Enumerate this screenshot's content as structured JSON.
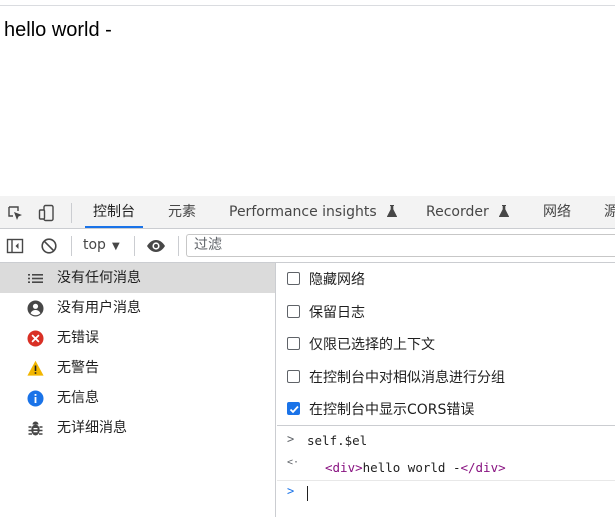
{
  "page": {
    "text": "hello world -"
  },
  "devtools": {
    "tabs": [
      {
        "label": "控制台",
        "active": true
      },
      {
        "label": "元素",
        "active": false
      },
      {
        "label": "Performance insights",
        "active": false,
        "experimental": true
      },
      {
        "label": "Recorder",
        "active": false,
        "experimental": true
      },
      {
        "label": "网络",
        "active": false
      },
      {
        "label": "源",
        "active": false
      }
    ]
  },
  "toolbar": {
    "context_value": "top",
    "filter_placeholder": "过滤"
  },
  "sidebar": {
    "items": [
      {
        "label": "没有任何消息",
        "icon": "list-icon",
        "selected": true
      },
      {
        "label": "没有用户消息",
        "icon": "user-icon",
        "selected": false
      },
      {
        "label": "无错误",
        "icon": "error-icon",
        "selected": false,
        "color": "#d93025"
      },
      {
        "label": "无警告",
        "icon": "warning-icon",
        "selected": false,
        "color": "#f2b600"
      },
      {
        "label": "无信息",
        "icon": "info-icon",
        "selected": false,
        "color": "#1a73e8"
      },
      {
        "label": "无详细消息",
        "icon": "bug-icon",
        "selected": false
      }
    ]
  },
  "settings": [
    {
      "label": "隐藏网络",
      "checked": false
    },
    {
      "label": "保留日志",
      "checked": false
    },
    {
      "label": "仅限已选择的上下文",
      "checked": false
    },
    {
      "label": "在控制台中对相似消息进行分组",
      "checked": false
    },
    {
      "label": "在控制台中显示CORS错误",
      "checked": true
    }
  ],
  "console": {
    "input_prompt": ">",
    "command": "self.$el",
    "result_prompt": "<·",
    "result_open_tag": "<div>",
    "result_text": "hello world -",
    "result_close_tag": "</div>",
    "new_prompt": ">"
  },
  "colors": {
    "accent": "#1a73e8",
    "error": "#d93025",
    "warning": "#f2b600",
    "tag": "#881280"
  }
}
